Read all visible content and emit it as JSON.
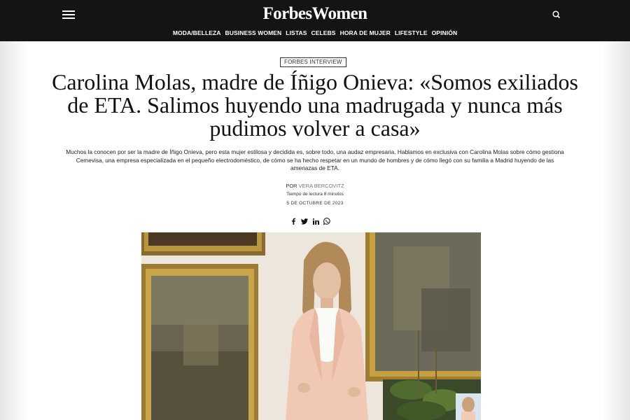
{
  "header": {
    "brand": "ForbesWomen",
    "menu_icon": "hamburger-menu-icon",
    "search_icon": "search-icon",
    "nav": [
      "MODA/BELLEZA",
      "BUSINESS WOMEN",
      "LISTAS",
      "CELEBS",
      "HORA DE MUJER",
      "LIFESTYLE",
      "OPINIÓN"
    ]
  },
  "article": {
    "tag": "FORBES INTERVIEW",
    "headline": "Carolina Molas, madre de Íñigo Onieva: «Somos exiliados de ETA. Salimos huyendo una madrugada y nunca más pudimos volver a casa»",
    "dek": "Muchos la conocen por ser la madre de Íñigo Onieva, pero esta mujer estilosa y decidida es, sobre todo, una audaz empresaria. Hablamos en exclusiva con Carolina Molas sobre cómo gestiona Cemevisa, una empresa especializada en el pequeño electrodoméstico, de cómo se ha hecho respetar en un mundo de hombres y de cómo llegó con su familia a Madrid huyendo de las amenazas de ETA.",
    "byline_prefix": "POR",
    "author": "VERA BERCOVITZ",
    "reading_time": "Tiempo de lectura 8 minutos",
    "date": "5 DE OCTUBRE DE 2023",
    "share_icons": [
      "facebook-icon",
      "twitter-icon",
      "linkedin-icon",
      "whatsapp-icon"
    ]
  },
  "colors": {
    "topbar": "#141414",
    "text": "#111111",
    "author_link": "#777777",
    "blazer": "#f1c8b3"
  }
}
